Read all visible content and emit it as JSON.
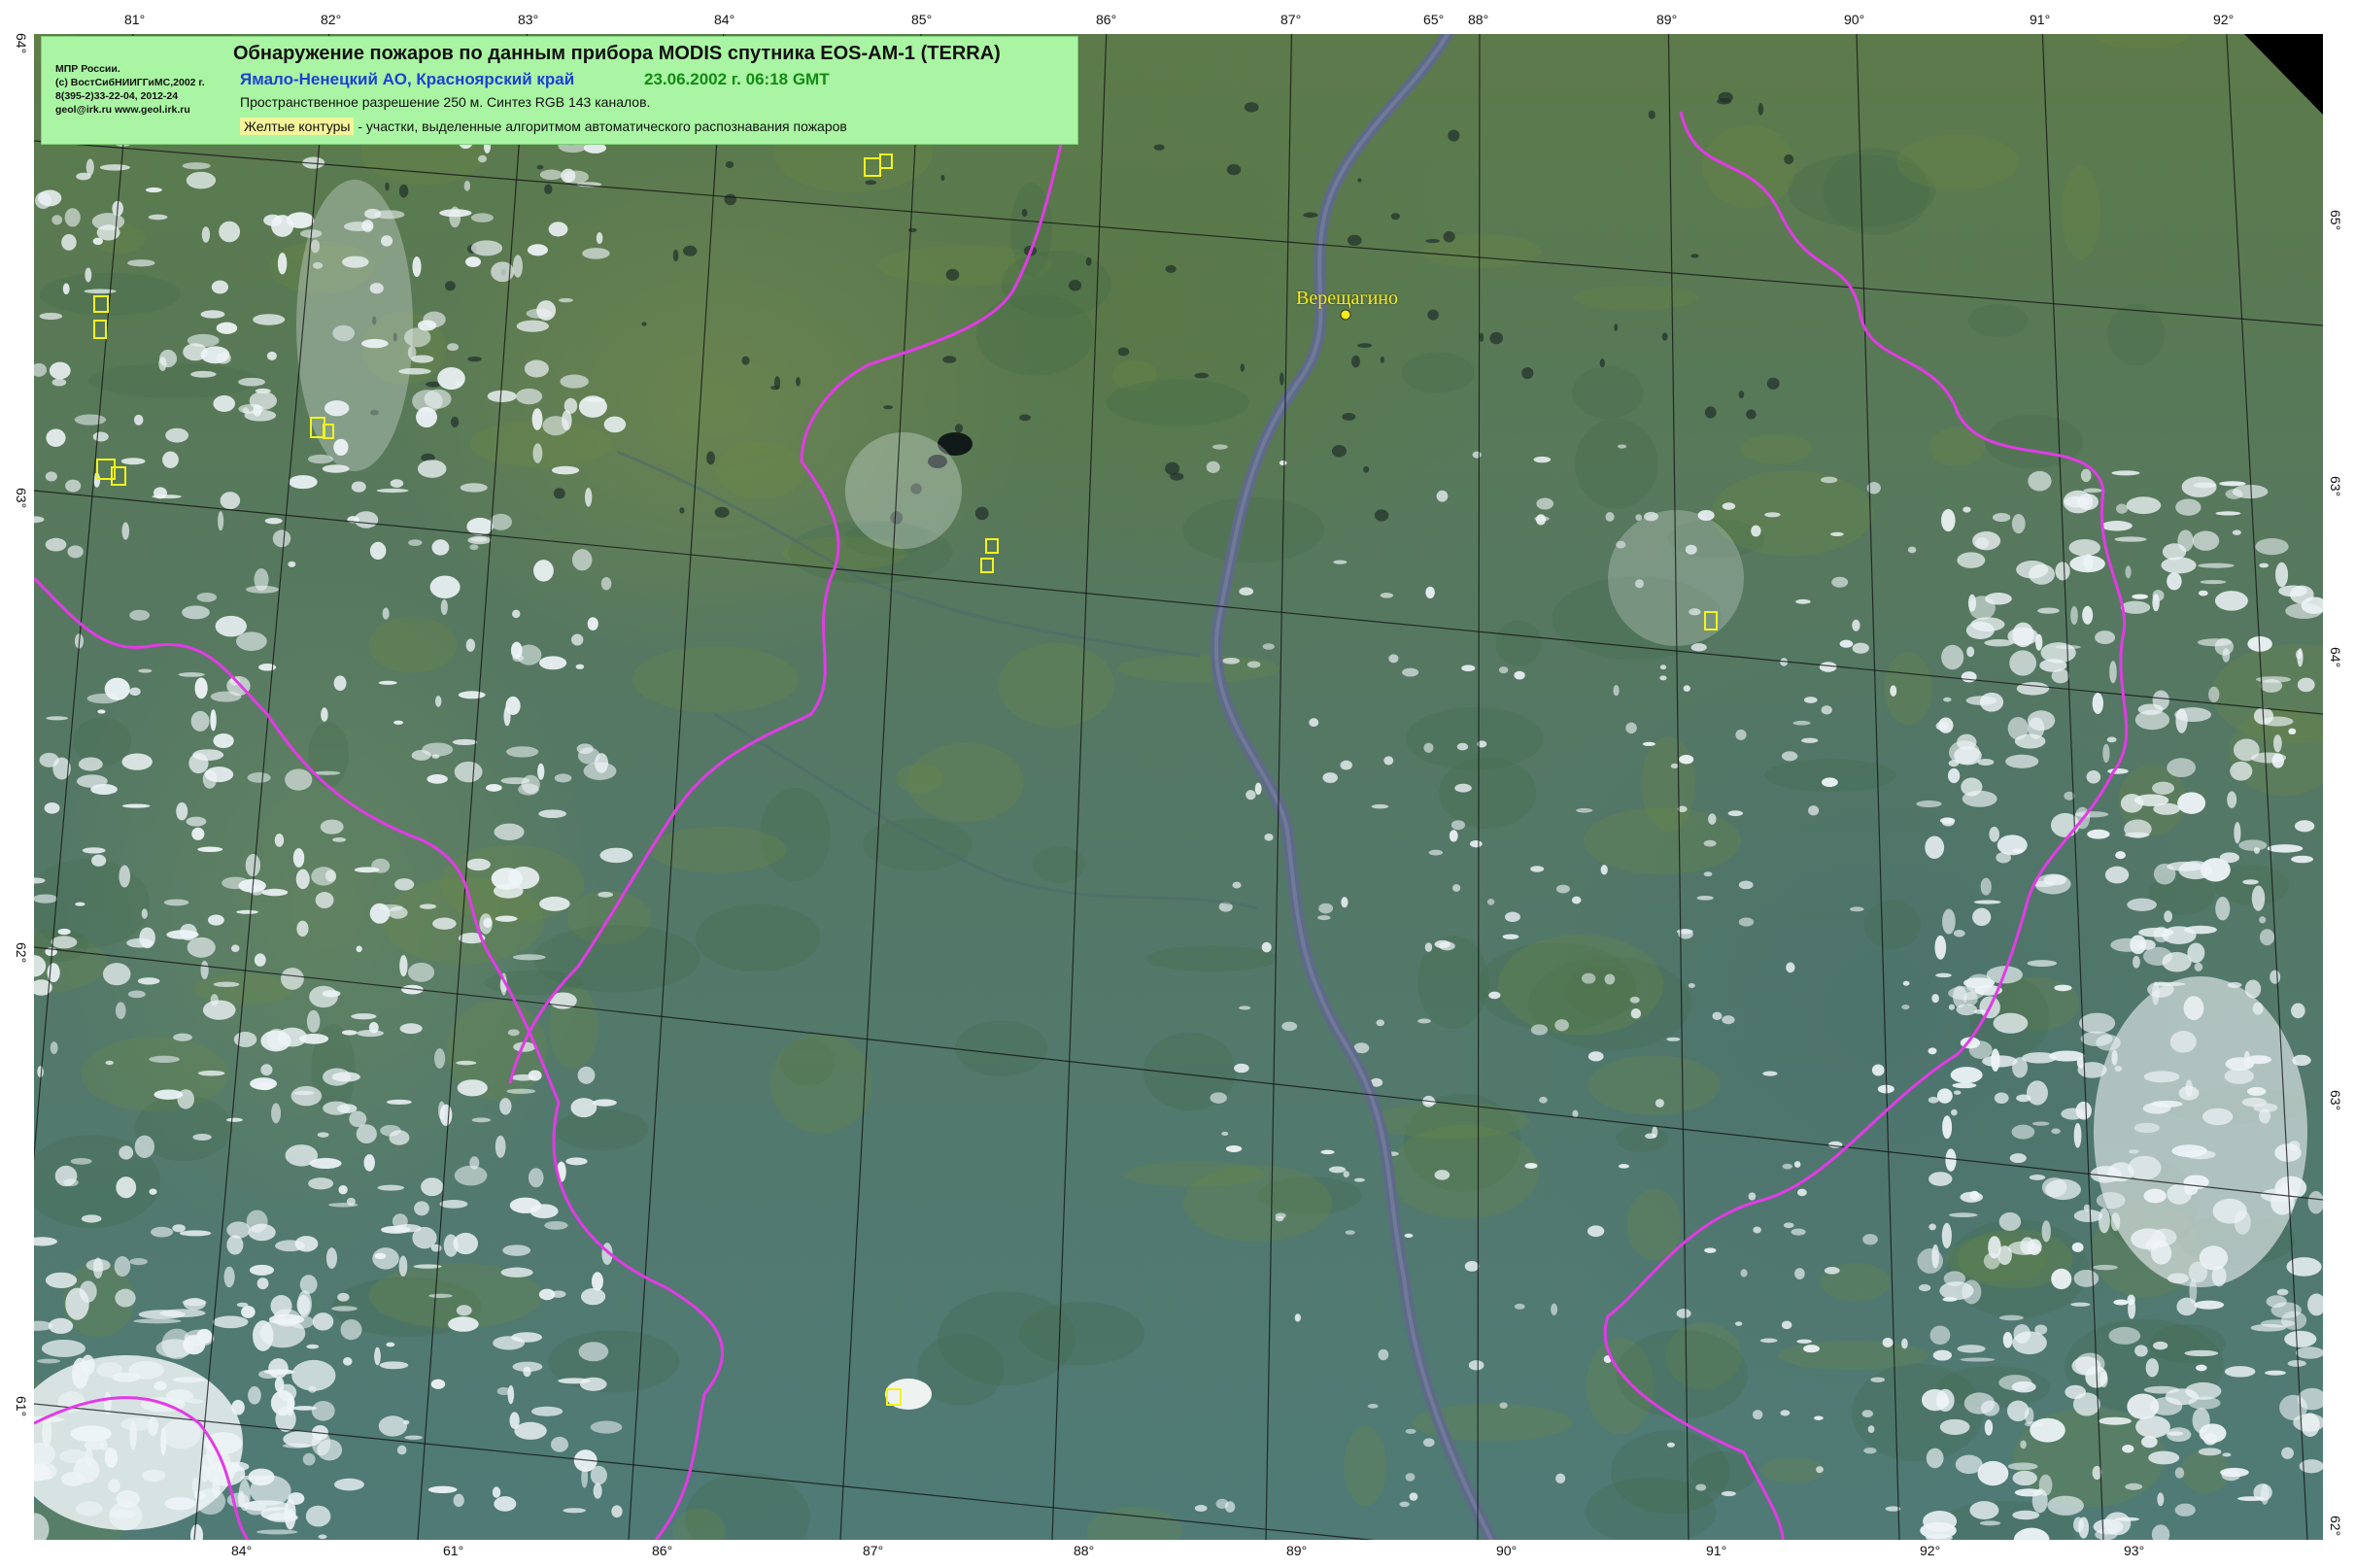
{
  "header": {
    "title": "Обнаружение пожаров по данным прибора MODIS спутника EOS-AM-1 (TERRA)",
    "region": "Ямало-Ненецкий АО, Красноярский край",
    "date": "23.06.2002 г. 06:18 GMT",
    "resolution": "Пространственное разрешение 250 м. Синтез RGB 143 каналов.",
    "legend_highlight": "Желтые контуры",
    "legend_text": " - участки, выделенные алгоритмом автоматического распознавания пожаров",
    "org_line1": "МПР России.",
    "org_line2": "(с) ВостСибНИИГГиМС,2002 г.",
    "org_line3": "8(395-2)33-22-04, 2012-24",
    "org_line4": "geol@irk.ru  www.geol.irk.ru"
  },
  "map": {
    "place_name": "Верещагино",
    "colors": {
      "boundary": "#e23be6",
      "fire_contour": "#f3f31d",
      "grid": "#101010",
      "river": "#5e6a88",
      "cloud": "#eef4f7"
    }
  },
  "ticks": {
    "top": [
      "81°",
      "82°",
      "83°",
      "84°",
      "85°",
      "86°",
      "87°",
      "65°",
      "88°",
      "89°",
      "90°",
      "91°",
      "92°"
    ],
    "bottom": [
      "84°",
      "61°",
      "86°",
      "87°",
      "88°",
      "89°",
      "90°",
      "91°",
      "92°",
      "93°"
    ],
    "left": [
      "64°",
      "63°",
      "62°",
      "61°"
    ],
    "right": [
      "65°",
      "63°",
      "64°",
      "63°",
      "62°"
    ]
  }
}
